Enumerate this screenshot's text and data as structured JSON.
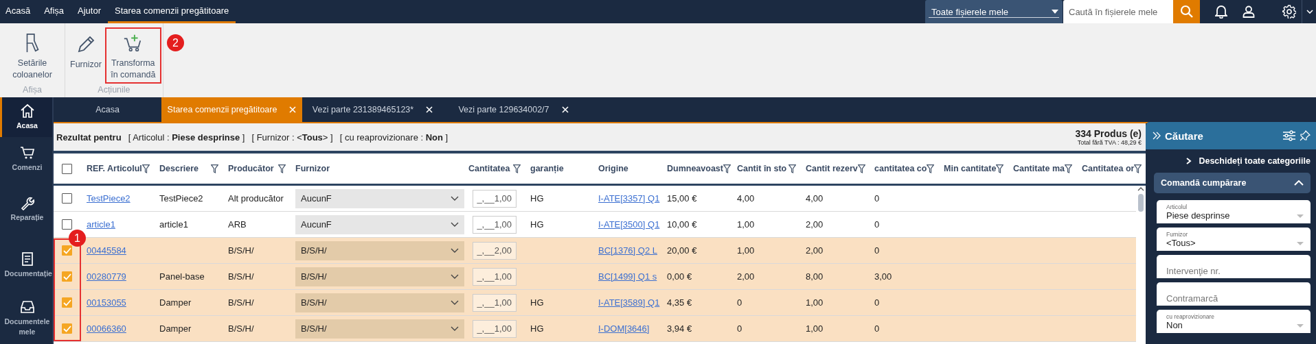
{
  "menu": [
    {
      "label": "Acasă",
      "selected": false
    },
    {
      "label": "Afișa",
      "selected": false
    },
    {
      "label": "Ajutor",
      "selected": false
    },
    {
      "label": "Starea comenzii pregătitoare",
      "selected": true
    }
  ],
  "scope_select": {
    "value": "Toate fișierele mele"
  },
  "search": {
    "placeholder": "Caută în fișierele mele"
  },
  "ribbon": {
    "groups": [
      {
        "label": "Afișa",
        "buttons": [
          {
            "label": "Setările coloanelor",
            "kind": "columns"
          }
        ]
      },
      {
        "label": "Acțiunile",
        "buttons": [
          {
            "label": "Furnizor",
            "kind": "pencil"
          },
          {
            "label": "Transforma în comandă",
            "kind": "cart",
            "callout": "2"
          }
        ]
      }
    ]
  },
  "sidebar": [
    {
      "label": "Acasa",
      "kind": "home",
      "selected": true
    },
    {
      "label": "Comenzi",
      "kind": "cart",
      "selected": false
    },
    {
      "label": "Reparație",
      "kind": "wrench",
      "selected": false
    },
    {
      "label": "Documentație",
      "kind": "document",
      "selected": false
    },
    {
      "label": "Documentele mele",
      "kind": "inbox",
      "selected": false
    }
  ],
  "tabs": [
    {
      "label": "Acasa",
      "selected": false,
      "closable": false
    },
    {
      "label": "Starea comenzii pregătitoare",
      "selected": true,
      "closable": true
    },
    {
      "label": "Vezi parte 231389465123*",
      "selected": false,
      "closable": true
    },
    {
      "label": "Vezi parte 129634002/7",
      "selected": false,
      "closable": true
    }
  ],
  "result": {
    "title": "Rezultat pentru",
    "filters": [
      "[ Articolul : **Piese desprinse** ]",
      "[ Furnizor : <**Tous**> ]",
      "[ cu reaprovizionare : **Non** ]"
    ],
    "count": "334 Produs (e)",
    "total": "Total fără TVA : 48,29 €"
  },
  "table": {
    "select_all": {
      "checked": false
    },
    "callout": "1",
    "columns": [
      {
        "label": "REF. Articolul",
        "filter": true,
        "kind": "link"
      },
      {
        "label": "Descriere",
        "filter": true,
        "kind": "text"
      },
      {
        "label": "Producător",
        "filter": true,
        "kind": "text"
      },
      {
        "label": "Furnizor",
        "filter": false,
        "kind": "select"
      },
      {
        "label": "Cantitatea",
        "filter": true,
        "kind": "input"
      },
      {
        "label": "garanție",
        "filter": false,
        "kind": "text"
      },
      {
        "label": "Origine",
        "filter": false,
        "kind": "link"
      },
      {
        "label": "Dumneavoast",
        "filter": true,
        "kind": "text"
      },
      {
        "label": "Cantit în sto",
        "filter": true,
        "kind": "text"
      },
      {
        "label": "Cantit rezerv",
        "filter": true,
        "kind": "text"
      },
      {
        "label": "cantitatea co",
        "filter": true,
        "kind": "text"
      },
      {
        "label": "Min cantitate",
        "filter": true
      },
      {
        "label": "Cantitate ma",
        "filter": true
      },
      {
        "label": "Cantitatea or",
        "filter": true
      }
    ],
    "rows": [
      {
        "checked": false,
        "ref": "TestPiece2",
        "description": "TestPiece2",
        "manufacturer": "Alt producător",
        "supplier": "AucunF",
        "quantity": "_,__1,00",
        "warranty": "HG",
        "origin": "I-ATE[3357] Q1",
        "price": "15,00 €",
        "stock": "4,00",
        "reserved": "4,00",
        "ordered": "0"
      },
      {
        "checked": false,
        "ref": "article1",
        "description": "article1",
        "manufacturer": "ARB",
        "supplier": "AucunF",
        "quantity": "_,__1,00",
        "warranty": "HG",
        "origin": "I-ATE[3500] Q1",
        "price": "10,00 €",
        "stock": "1,00",
        "reserved": "2,00",
        "ordered": "0"
      },
      {
        "checked": true,
        "ref": "00445584",
        "manufacturer": "B/S/H/",
        "supplier": "B/S/H/",
        "quantity": "_,__2,00",
        "origin": "BC[1376] Q2 L",
        "price": "20,00 €",
        "stock": "1,00",
        "reserved": "2,00",
        "ordered": "0"
      },
      {
        "checked": true,
        "ref": "00280779",
        "description": "Panel-base",
        "manufacturer": "B/S/H/",
        "supplier": "B/S/H/",
        "quantity": "_,__1,00",
        "origin": "BC[1499] Q1 s",
        "price": "0,00 €",
        "stock": "2,00",
        "reserved": "8,00",
        "ordered": "3,00"
      },
      {
        "checked": true,
        "ref": "00153055",
        "description": "Damper",
        "manufacturer": "B/S/H/",
        "supplier": "B/S/H/",
        "quantity": "_,__1,00",
        "warranty": "HG",
        "origin": "I-ATE[3589] Q1",
        "price": "4,35 €",
        "stock": "0",
        "reserved": "1,00",
        "ordered": "0"
      },
      {
        "checked": true,
        "ref": "00066360",
        "description": "Damper",
        "manufacturer": "B/S/H/",
        "supplier": "B/S/H/",
        "quantity": "_,__1,00",
        "warranty": "HG",
        "origin": "I-DOM[3646]",
        "price": "3,94 €",
        "stock": "0",
        "reserved": "1,00",
        "ordered": "0"
      }
    ]
  },
  "search_panel": {
    "title": "Căutare",
    "open_all": "Deschideți toate categoriile",
    "section": {
      "title": "Comandă cumpărare",
      "expanded": true
    },
    "fields": [
      {
        "kind": "select",
        "label": "Articolul",
        "value": "Piese desprinse"
      },
      {
        "kind": "select",
        "label": "Furnizor",
        "value": "<Tous>"
      },
      {
        "kind": "input",
        "placeholder": "Intervenţie nr."
      },
      {
        "kind": "input",
        "placeholder": "Contramarcă"
      },
      {
        "kind": "select",
        "label": "cu reaprovizionare",
        "value": "Non"
      }
    ]
  }
}
